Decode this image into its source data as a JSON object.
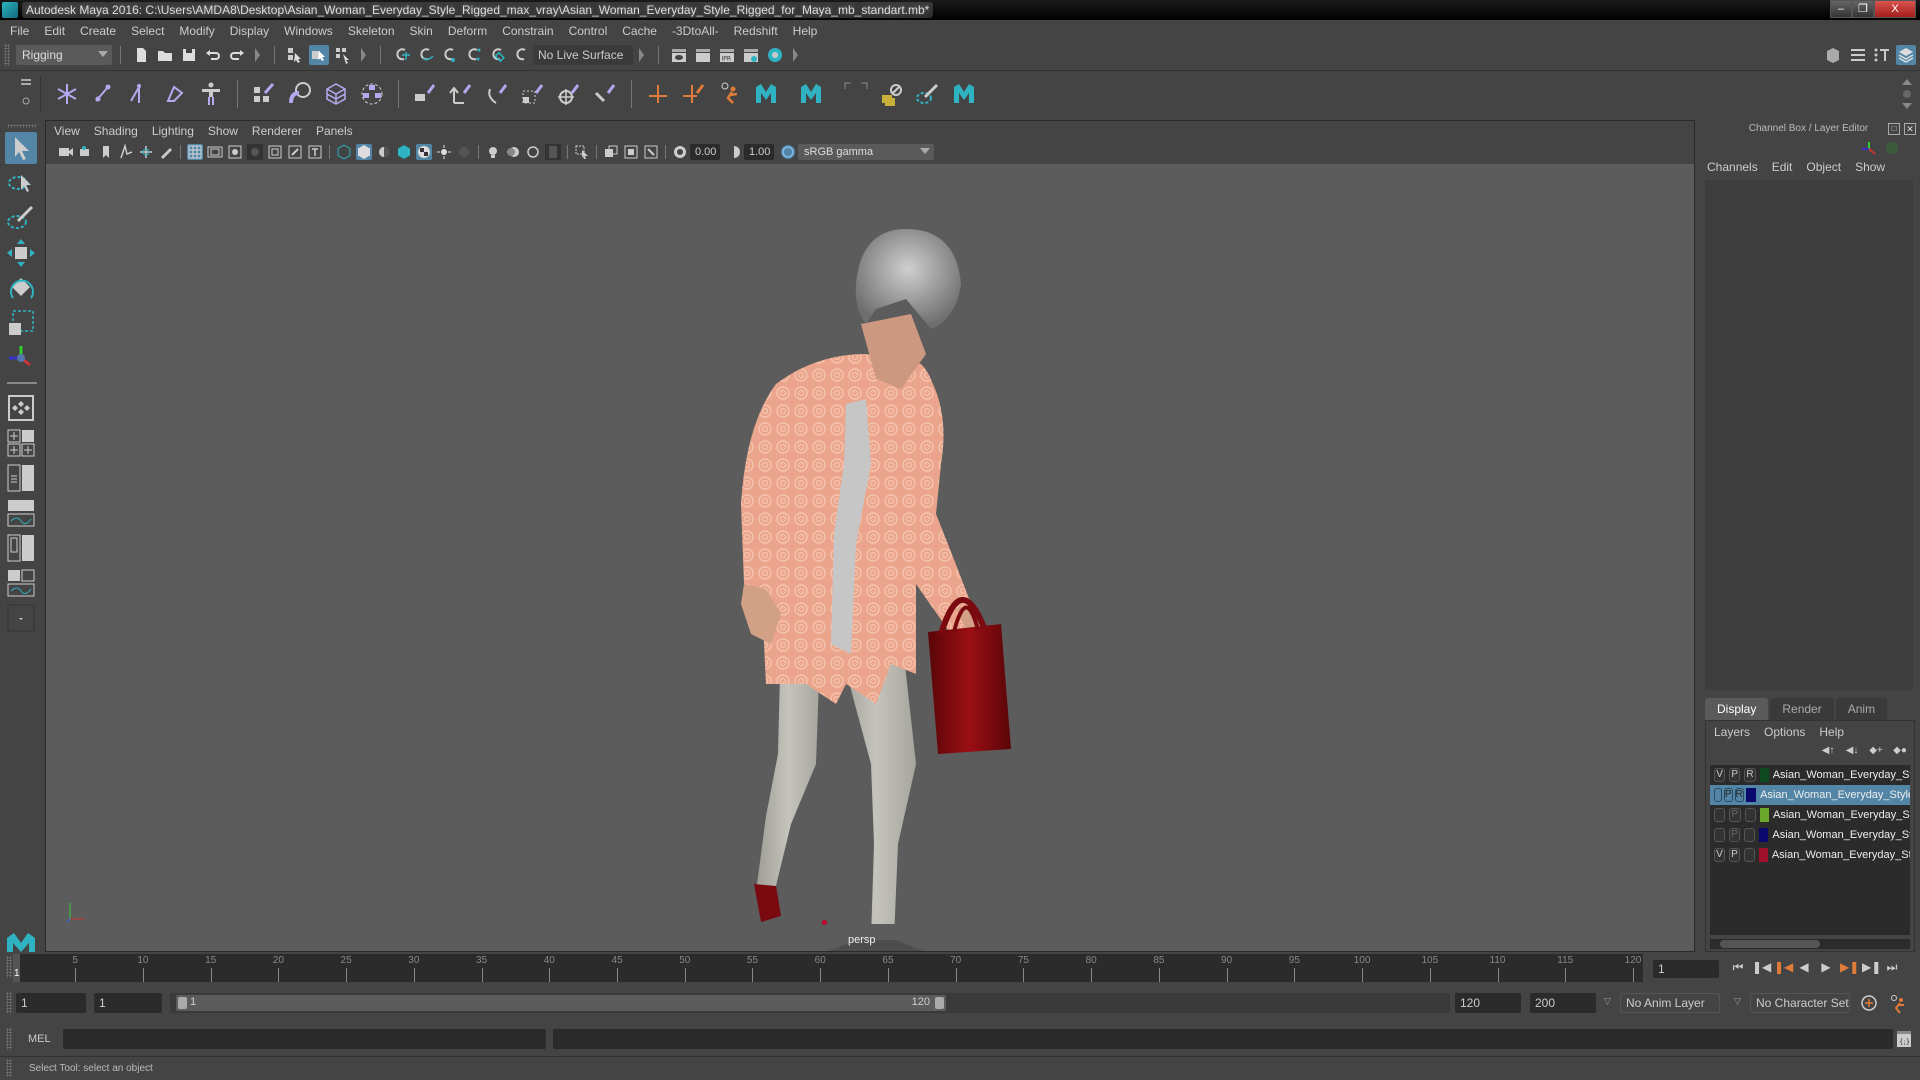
{
  "window": {
    "title": "Autodesk Maya 2016: C:\\Users\\AMDA8\\Desktop\\Asian_Woman_Everyday_Style_Rigged_max_vray\\Asian_Woman_Everyday_Style_Rigged_for_Maya_mb_standart.mb*",
    "minimize": "–",
    "restore": "❐",
    "close": "X"
  },
  "menubar": [
    "File",
    "Edit",
    "Create",
    "Select",
    "Modify",
    "Display",
    "Windows",
    "Skeleton",
    "Skin",
    "Deform",
    "Constrain",
    "Control",
    "Cache",
    "-3DtoAll-",
    "Redshift",
    "Help"
  ],
  "statusline": {
    "menuset": "Rigging",
    "live_surface": "No Live Surface"
  },
  "panel": {
    "menus": [
      "View",
      "Shading",
      "Lighting",
      "Show",
      "Renderer",
      "Panels"
    ],
    "exposure": "0.00",
    "gamma": "1.00",
    "color_space": "sRGB gamma",
    "camera": "persp"
  },
  "channel_box": {
    "title": "Channel Box / Layer Editor",
    "menus": [
      "Channels",
      "Edit",
      "Object",
      "Show"
    ]
  },
  "layer_editor": {
    "tabs": [
      "Display",
      "Render",
      "Anim"
    ],
    "active_tab": "Display",
    "menus": [
      "Layers",
      "Options",
      "Help"
    ],
    "layers": [
      {
        "v": "V",
        "p": "P",
        "r": "R",
        "color": "#0d4a1f",
        "name": "Asian_Woman_Everyday_Style_Rigged_controls",
        "selected": false
      },
      {
        "v": "",
        "p": "P",
        "r": "R",
        "color": "#0a0a6e",
        "name": "Asian_Woman_Everyday_Style_Rigged_bones",
        "selected": true
      },
      {
        "v": "",
        "p": "P",
        "r": "",
        "color": "#6aa82a",
        "name": "Asian_Woman_Everyday_Style_Rigged_helpers",
        "selected": false
      },
      {
        "v": "",
        "p": "P",
        "r": "",
        "color": "#0a0a6e",
        "name": "Asian_Woman_Everyday_Style_Rigged_skeleton",
        "selected": false
      },
      {
        "v": "V",
        "p": "P",
        "r": "",
        "color": "#a0102a",
        "name": "Asian_Woman_Everyday_Style_Rigged_geometry",
        "selected": false
      }
    ]
  },
  "timeline": {
    "ticks": [
      5,
      10,
      15,
      20,
      25,
      30,
      35,
      40,
      45,
      50,
      55,
      60,
      65,
      70,
      75,
      80,
      85,
      90,
      95,
      100,
      105,
      110,
      115,
      120
    ],
    "current_frame": "1",
    "current_frame_field": "1",
    "start": 1,
    "end": 120
  },
  "range": {
    "anim_start": "1",
    "play_start": "1",
    "slider_start": "1",
    "slider_end": "120",
    "play_end": "120",
    "anim_end": "200",
    "anim_layer": "No Anim Layer",
    "character_set": "No Character Set"
  },
  "cmdline": {
    "label": "MEL"
  },
  "helpline": {
    "text": "Select Tool: select an object"
  },
  "colors": {
    "accent": "#5285a6",
    "viewport_bg": "#5c5c5c",
    "panel_bg": "#444444",
    "field_bg": "#2b2b2b",
    "orange": "#e07b39",
    "teal": "#2fb3c3"
  }
}
